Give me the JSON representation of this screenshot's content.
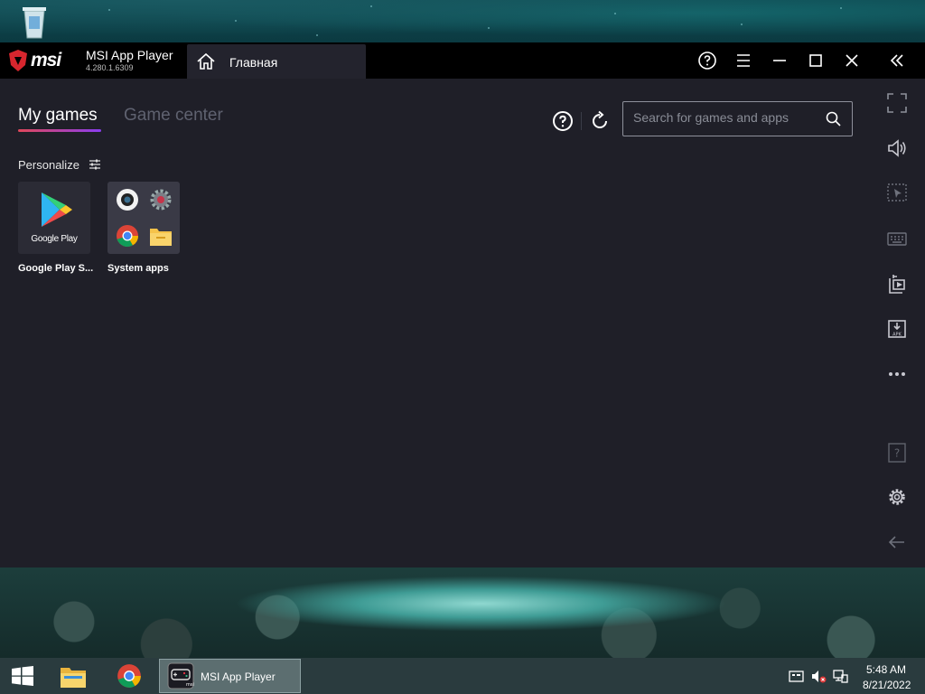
{
  "app": {
    "brand": "msi",
    "title": "MSI App Player",
    "version": "4.280.1.6309",
    "home_tab_label": "Главная"
  },
  "tabs": [
    {
      "label": "My games",
      "active": true
    },
    {
      "label": "Game center",
      "active": false
    }
  ],
  "search": {
    "placeholder": "Search for games and apps"
  },
  "personalize_label": "Personalize",
  "apps": [
    {
      "label": "Google Play S...",
      "icon": "google-play-icon",
      "tile_text": "Google Play"
    },
    {
      "label": "System apps",
      "icon": "system-apps-folder"
    }
  ],
  "sidebar_icons": [
    "fullscreen-icon",
    "volume-icon",
    "cursor-select-icon",
    "keyboard-icon",
    "media-manager-icon",
    "apk-install-icon",
    "more-icon",
    "help-icon",
    "settings-icon",
    "back-icon"
  ],
  "taskbar": {
    "active_app_label": "MSI App Player",
    "time": "5:48 AM",
    "date": "8/21/2022"
  },
  "colors": {
    "accent_start": "#e0475a",
    "accent_end": "#8a3df0",
    "content_bg": "#1f1f28",
    "titlebar_bg": "#000000",
    "msi_red": "#d7262e"
  }
}
